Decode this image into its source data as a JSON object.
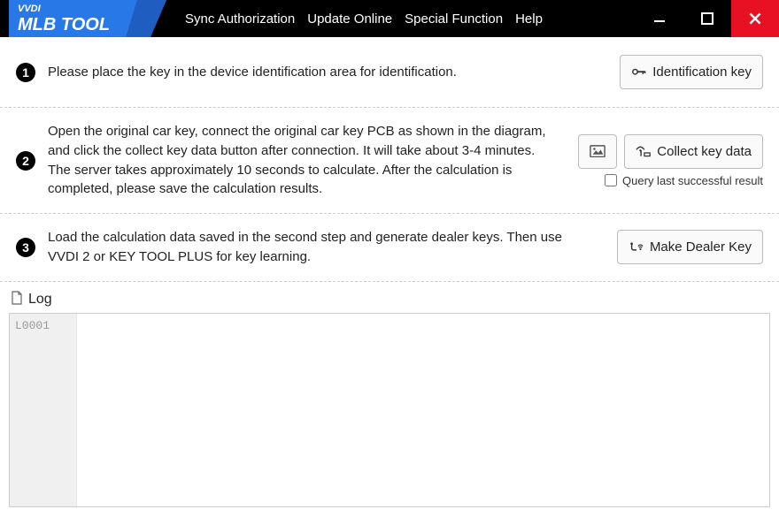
{
  "titlebar": {
    "brand_top": "VVDI",
    "brand_bottom": "MLB TOOL"
  },
  "menu": {
    "sync": "Sync Authorization",
    "update": "Update Online",
    "special": "Special Function",
    "help": "Help"
  },
  "steps": {
    "s1": {
      "num": "1",
      "text": "Please place the key in the device identification area for identification.",
      "btn": "Identification key"
    },
    "s2": {
      "num": "2",
      "text": "Open the original car key, connect the original car key PCB as shown in the diagram, and click the collect key data button after connection. It will take about 3-4 minutes. The server takes approximately 10 seconds to calculate. After the calculation is completed, please save the calculation results.",
      "btn": "Collect key data",
      "checkbox": "Query last successful result"
    },
    "s3": {
      "num": "3",
      "text": "Load the calculation data saved in the second step and generate dealer keys. Then use VVDI 2 or KEY TOOL PLUS for key learning.",
      "btn": "Make Dealer Key"
    }
  },
  "log": {
    "title": "Log",
    "line1": "L0001"
  }
}
